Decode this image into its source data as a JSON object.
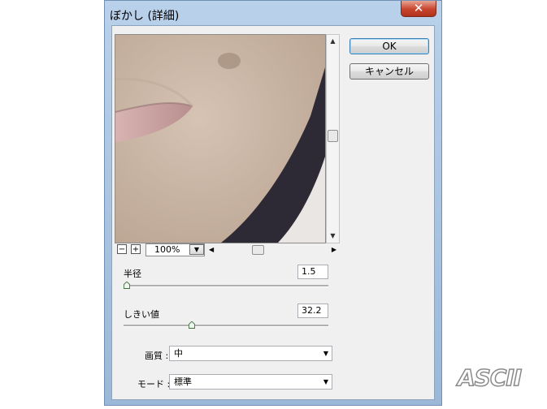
{
  "window": {
    "title": "ぼかし (詳細)",
    "close_label": "✕"
  },
  "buttons": {
    "ok": "OK",
    "cancel": "キャンセル"
  },
  "preview": {
    "zoom_out": "−",
    "zoom_in": "+",
    "zoom": "100%"
  },
  "radius": {
    "label": "半径",
    "value": "1.5",
    "level": 0.0
  },
  "threshold": {
    "label": "しきい値",
    "value": "32.2",
    "level": 0.32
  },
  "quality": {
    "label": "画質 :",
    "value": "中"
  },
  "mode": {
    "label": "モード :",
    "value": "標準"
  },
  "icons": {
    "up": "▲",
    "down": "▼",
    "left": "◀",
    "right": "▶",
    "drop": "▼"
  },
  "watermark": "ASCII",
  "colors": {
    "skin": "#cbb7a6",
    "lips": "#c8a3a3",
    "shirt": "#2d2a35",
    "ok_border": "#3c7fb1"
  }
}
